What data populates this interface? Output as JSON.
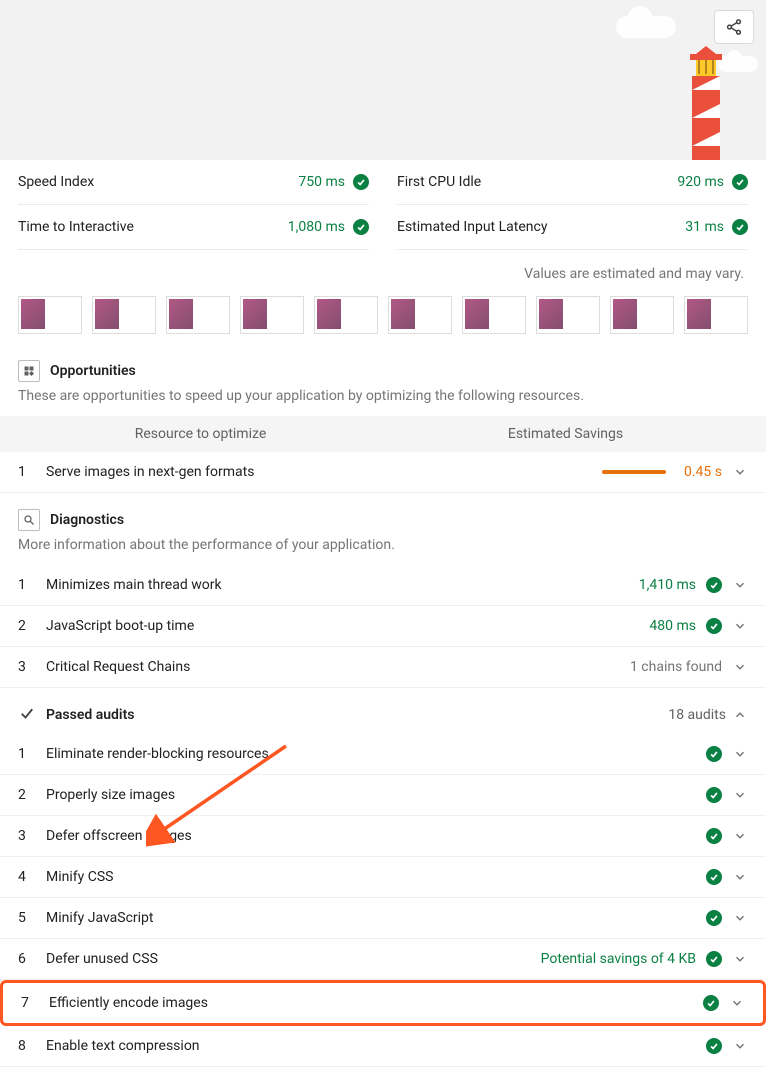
{
  "hero": {
    "share_tooltip": "Share"
  },
  "metrics": {
    "row1": [
      {
        "label": "Speed Index",
        "value": "750 ms",
        "passed": true
      },
      {
        "label": "First CPU Idle",
        "value": "920 ms",
        "passed": true
      }
    ],
    "row2": [
      {
        "label": "Time to Interactive",
        "value": "1,080 ms",
        "passed": true
      },
      {
        "label": "Estimated Input Latency",
        "value": "31 ms",
        "passed": true
      }
    ],
    "disclaimer": "Values are estimated and may vary."
  },
  "filmstrip_count": 10,
  "opportunities": {
    "title": "Opportunities",
    "subtitle": "These are opportunities to speed up your application by optimizing the following resources.",
    "col_resource": "Resource to optimize",
    "col_savings": "Estimated Savings",
    "items": [
      {
        "num": "1",
        "label": "Serve images in next-gen formats",
        "savings": "0.45 s"
      }
    ]
  },
  "diagnostics": {
    "title": "Diagnostics",
    "subtitle": "More information about the performance of your application.",
    "items": [
      {
        "num": "1",
        "label": "Minimizes main thread work",
        "value": "1,410 ms",
        "passed": true
      },
      {
        "num": "2",
        "label": "JavaScript boot-up time",
        "value": "480 ms",
        "passed": true
      },
      {
        "num": "3",
        "label": "Critical Request Chains",
        "value": "1 chains found",
        "passed": false
      }
    ]
  },
  "passed": {
    "title": "Passed audits",
    "count": "18 audits",
    "items": [
      {
        "num": "1",
        "label": "Eliminate render-blocking resources",
        "extra": ""
      },
      {
        "num": "2",
        "label": "Properly size images",
        "extra": ""
      },
      {
        "num": "3",
        "label": "Defer offscreen images",
        "extra": ""
      },
      {
        "num": "4",
        "label": "Minify CSS",
        "extra": ""
      },
      {
        "num": "5",
        "label": "Minify JavaScript",
        "extra": ""
      },
      {
        "num": "6",
        "label": "Defer unused CSS",
        "extra": "Potential savings of 4 KB"
      },
      {
        "num": "7",
        "label": "Efficiently encode images",
        "extra": "",
        "highlight": true
      },
      {
        "num": "8",
        "label": "Enable text compression",
        "extra": ""
      }
    ]
  }
}
